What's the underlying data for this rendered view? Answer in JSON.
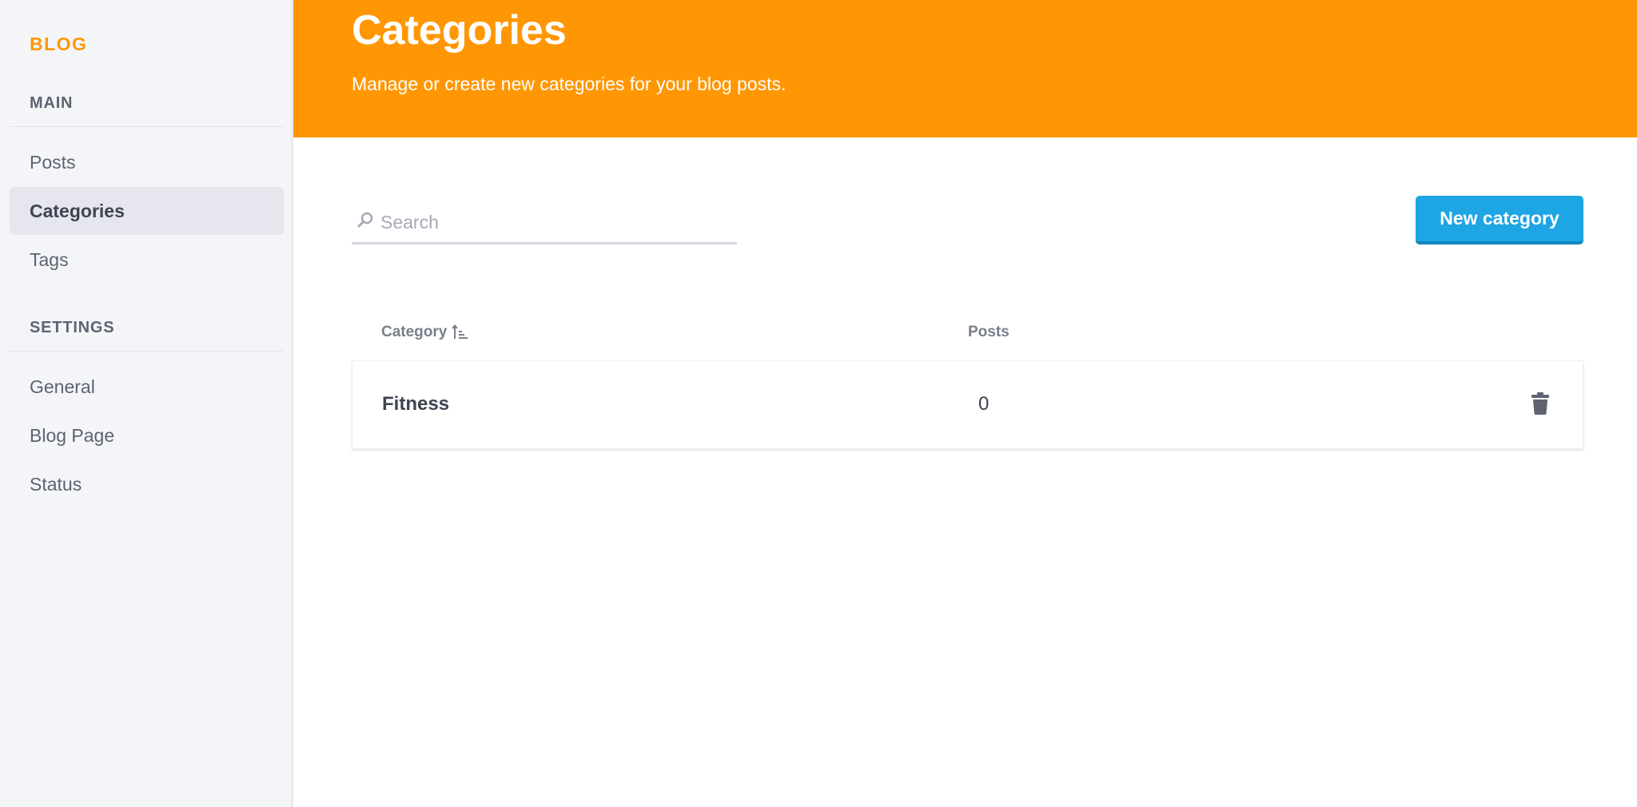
{
  "sidebar": {
    "brand": "BLOG",
    "sections": [
      {
        "title": "MAIN",
        "items": [
          {
            "label": "Posts",
            "active": false
          },
          {
            "label": "Categories",
            "active": true
          },
          {
            "label": "Tags",
            "active": false
          }
        ]
      },
      {
        "title": "SETTINGS",
        "items": [
          {
            "label": "General",
            "active": false
          },
          {
            "label": "Blog Page",
            "active": false
          },
          {
            "label": "Status",
            "active": false
          }
        ]
      }
    ]
  },
  "header": {
    "title": "Categories",
    "subtitle": "Manage or create new categories for your blog posts."
  },
  "toolbar": {
    "search_placeholder": "Search",
    "search_value": "",
    "new_button_label": "New category"
  },
  "table": {
    "columns": [
      "Category",
      "Posts"
    ],
    "sort_column": "Category",
    "sort_direction": "ascending",
    "rows": [
      {
        "category": "Fitness",
        "posts": "0"
      }
    ]
  },
  "icons": {
    "search": "search-icon",
    "sort": "sort-ascending-icon",
    "delete": "trash-icon"
  },
  "colors": {
    "brand": "#ff9704",
    "header_bg": "#ff9704",
    "primary_button": "#1ea5e3",
    "sidebar_bg": "#f4f5f9",
    "active_item_bg": "#e5e6ee"
  }
}
